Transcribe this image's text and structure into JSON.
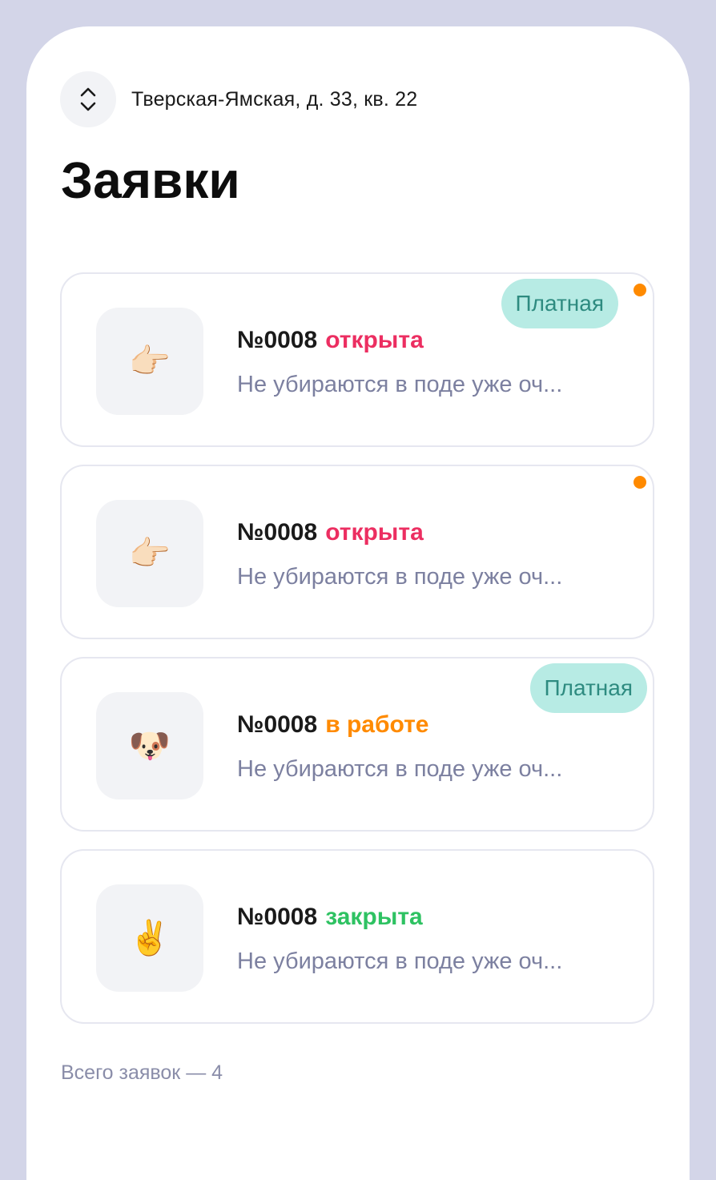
{
  "header": {
    "address": "Тверская-Ямская, д. 33, кв. 22",
    "switch_icon": "chevron-up-down-icon"
  },
  "page": {
    "title": "Заявки"
  },
  "requests": [
    {
      "icon": "👉🏻",
      "icon_name": "pointing-hand-icon",
      "number": "№0008",
      "status": "открыта",
      "status_color": "#ec2e61",
      "description": "Не убираются в поде уже оч...",
      "badge": "Платная",
      "unread": true
    },
    {
      "icon": "👉🏻",
      "icon_name": "pointing-hand-icon",
      "number": "№0008",
      "status": "открыта",
      "status_color": "#ec2e61",
      "description": "Не убираются в поде уже оч...",
      "badge": "",
      "unread": true
    },
    {
      "icon": "🐶",
      "icon_name": "dog-face-icon",
      "number": "№0008",
      "status": "в работе",
      "status_color": "#ff8a00",
      "description": "Не убираются в поде уже оч...",
      "badge": "Платная",
      "unread": false
    },
    {
      "icon": "✌️",
      "icon_name": "victory-hand-icon",
      "number": "№0008",
      "status": "закрыта",
      "status_color": "#2ec262",
      "description": "Не убираются в поде уже оч...",
      "badge": "",
      "unread": false
    }
  ],
  "footer": {
    "total_label": "Всего заявок — 4"
  },
  "colors": {
    "background": "#d3d5e8",
    "badge_bg": "#b7ebe4",
    "badge_text": "#2e8b80",
    "unread_dot": "#ff8a00",
    "description": "#7c80a0"
  }
}
